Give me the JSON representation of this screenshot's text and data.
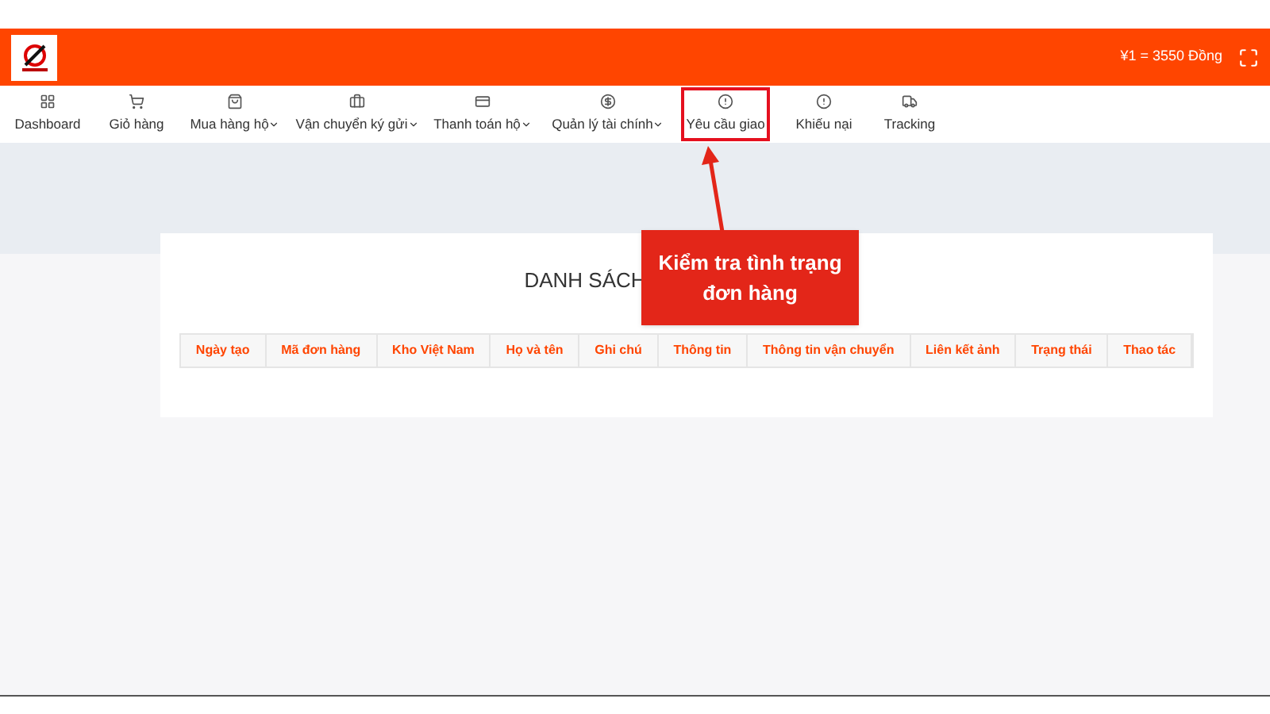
{
  "header": {
    "rate": "¥1 = 3550 Đồng"
  },
  "nav": [
    {
      "label": "Dashboard",
      "dropdown": false,
      "highlighted": false
    },
    {
      "label": "Giỏ hàng",
      "dropdown": false,
      "highlighted": false
    },
    {
      "label": "Mua hàng hộ",
      "dropdown": true,
      "highlighted": false
    },
    {
      "label": "Vận chuyển ký gửi",
      "dropdown": true,
      "highlighted": false
    },
    {
      "label": "Thanh toán hộ",
      "dropdown": true,
      "highlighted": false
    },
    {
      "label": "Quản lý tài chính",
      "dropdown": true,
      "highlighted": false
    },
    {
      "label": "Yêu cầu giao",
      "dropdown": false,
      "highlighted": true
    },
    {
      "label": "Khiếu nại",
      "dropdown": false,
      "highlighted": false
    },
    {
      "label": "Tracking",
      "dropdown": false,
      "highlighted": false
    }
  ],
  "card": {
    "title": "DANH SÁCH",
    "columns": [
      "Ngày tạo",
      "Mã đơn hàng",
      "Kho Việt Nam",
      "Họ và tên",
      "Ghi chú",
      "Thông tin",
      "Thông tin vận chuyển",
      "Liên kết ảnh",
      "Trạng thái",
      "Thao tác"
    ]
  },
  "callout": {
    "text": "Kiểm tra tình trạng đơn hàng"
  }
}
